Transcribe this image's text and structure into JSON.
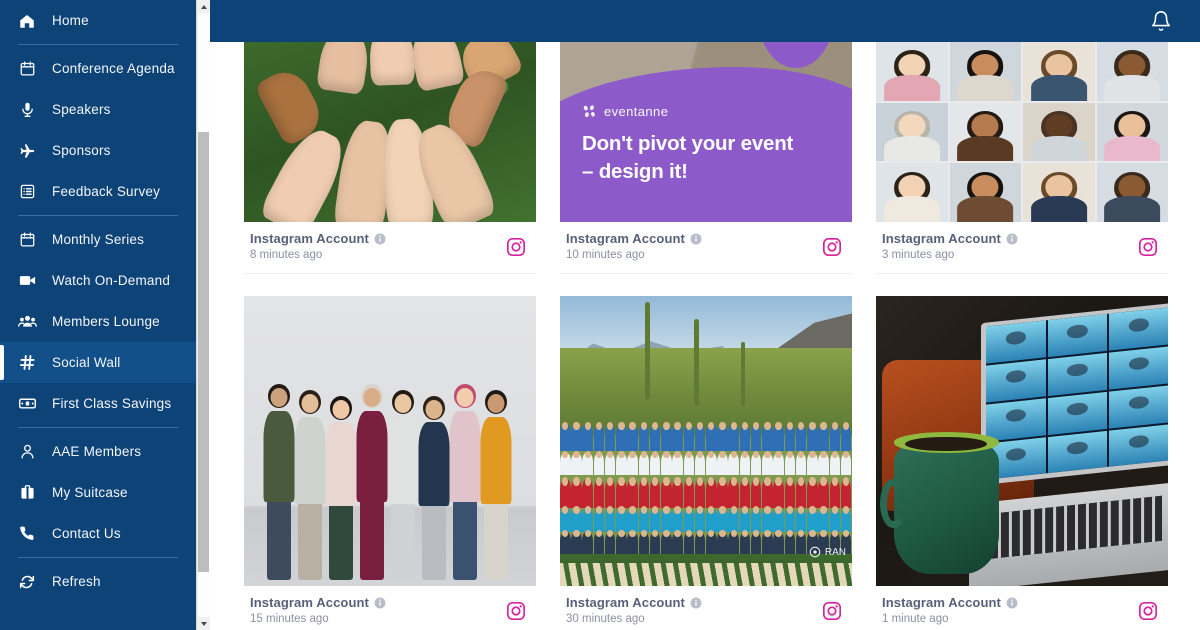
{
  "sidebar": {
    "items": [
      {
        "label": "Home",
        "icon": "home-icon",
        "active": false,
        "divider_after": true
      },
      {
        "label": "Conference Agenda",
        "icon": "calendar-icon",
        "active": false,
        "divider_after": false
      },
      {
        "label": "Speakers",
        "icon": "microphone-icon",
        "active": false,
        "divider_after": false
      },
      {
        "label": "Sponsors",
        "icon": "airplane-icon",
        "active": false,
        "divider_after": false
      },
      {
        "label": "Feedback Survey",
        "icon": "list-form-icon",
        "active": false,
        "divider_after": true
      },
      {
        "label": "Monthly Series",
        "icon": "calendar-icon",
        "active": false,
        "divider_after": false
      },
      {
        "label": "Watch On-Demand",
        "icon": "video-camera-icon",
        "active": false,
        "divider_after": false
      },
      {
        "label": "Members Lounge",
        "icon": "people-group-icon",
        "active": false,
        "divider_after": false
      },
      {
        "label": "Social Wall",
        "icon": "hashtag-icon",
        "active": true,
        "divider_after": false
      },
      {
        "label": "First Class Savings",
        "icon": "money-bill-icon",
        "active": false,
        "divider_after": true
      },
      {
        "label": "AAE Members",
        "icon": "user-icon",
        "active": false,
        "divider_after": false
      },
      {
        "label": "My Suitcase",
        "icon": "suitcase-icon",
        "active": false,
        "divider_after": false
      },
      {
        "label": "Contact Us",
        "icon": "phone-icon",
        "active": false,
        "divider_after": true
      },
      {
        "label": "Refresh",
        "icon": "refresh-icon",
        "active": false,
        "divider_after": false
      }
    ]
  },
  "header": {
    "notification_icon": "bell-icon"
  },
  "colors": {
    "sidebar_navy": "#0e4377",
    "sidebar_active": "#13508a",
    "instagram_pink": "#d6249f",
    "caption_title": "#59607a",
    "caption_time": "#8b90a3",
    "accent_purple": "#8d5bc9"
  },
  "wall": {
    "posts": [
      {
        "id": "post-1",
        "account": "Instagram Account",
        "timestamp": "8 minutes ago",
        "network_icon": "instagram-icon",
        "info_icon": "info-icon",
        "media": "hands-circle-on-grass"
      },
      {
        "id": "post-2",
        "account": "Instagram Account",
        "timestamp": "10 minutes ago",
        "network_icon": "instagram-icon",
        "info_icon": "info-icon",
        "media": "eventanne-graphic",
        "overlay": {
          "brand": "eventanne",
          "headline_line1": "Don't pivot your event",
          "headline_line2": "– design it!"
        }
      },
      {
        "id": "post-3",
        "account": "Instagram Account",
        "timestamp": "3 minutes ago",
        "network_icon": "instagram-icon",
        "info_icon": "info-icon",
        "media": "video-call-faces-grid"
      },
      {
        "id": "post-4",
        "account": "Instagram Account",
        "timestamp": "15 minutes ago",
        "network_icon": "instagram-icon",
        "info_icon": "info-icon",
        "media": "group-of-women-laughing"
      },
      {
        "id": "post-5",
        "account": "Instagram Account",
        "timestamp": "30 minutes ago",
        "network_icon": "instagram-icon",
        "info_icon": "info-icon",
        "media": "large-group-desert-photo",
        "watermark": "RAN"
      },
      {
        "id": "post-6",
        "account": "Instagram Account",
        "timestamp": "1 minute ago",
        "network_icon": "instagram-icon",
        "info_icon": "info-icon",
        "media": "laptop-video-call-with-mug"
      }
    ]
  },
  "scrollbar": {
    "up_arrow_icon": "caret-up-icon",
    "down_arrow_icon": "caret-down-icon"
  }
}
